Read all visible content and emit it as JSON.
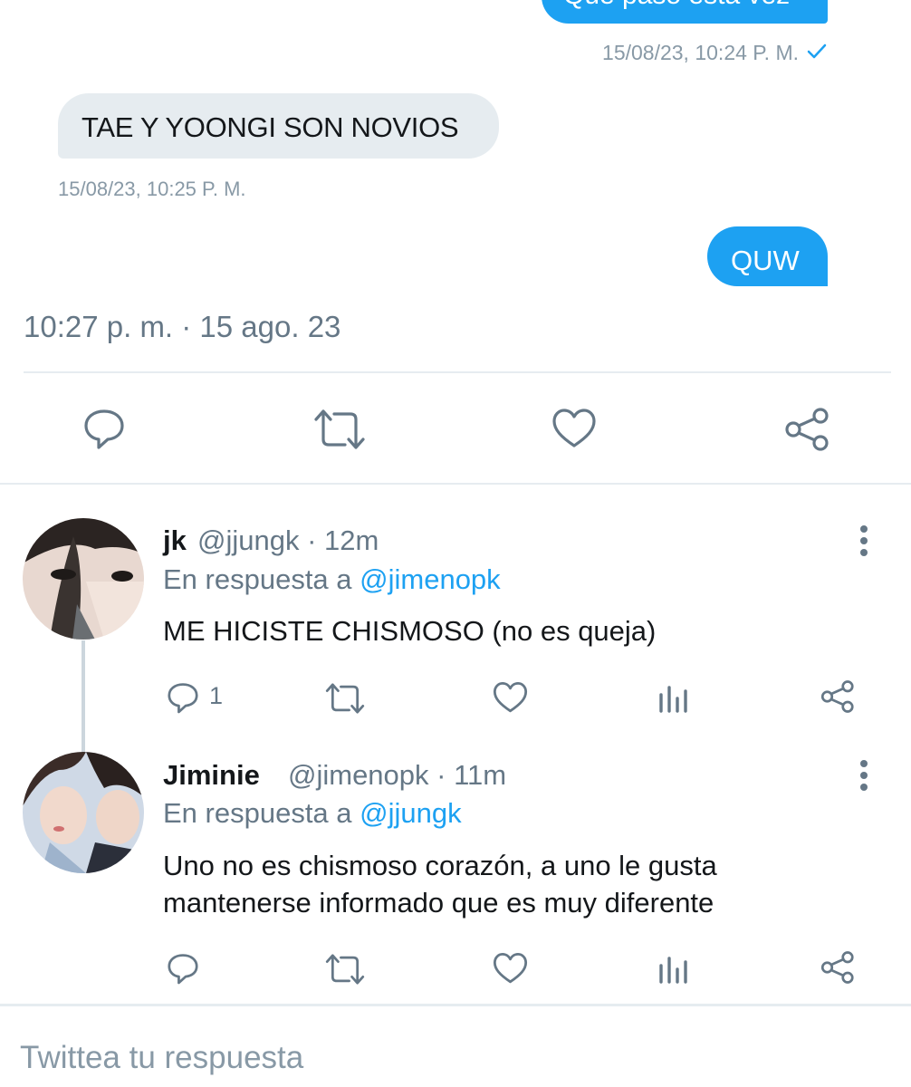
{
  "dm": {
    "top_bubble_text": "Que paso esta vez",
    "top_timestamp": "15/08/23, 10:24 P. M.",
    "incoming_text": "TAE Y YOONGI SON NOVIOS",
    "incoming_timestamp": "15/08/23, 10:25 P. M.",
    "quw_text": "QUW"
  },
  "tweet": {
    "time": "10:27 p. m. · 15 ago. 23"
  },
  "replies": [
    {
      "name": "jk",
      "handle": "@jjungk",
      "age": "· 12m",
      "reply_prefix": "En respuesta a ",
      "reply_to": "@jimenopk",
      "text": "ME HICISTE CHISMOSO (no es queja)",
      "reply_count": "1"
    },
    {
      "name": "Jiminie",
      "handle": "@jimenopk",
      "age": "· 11m",
      "reply_prefix": "En respuesta a ",
      "reply_to": "@jjungk",
      "text_line1": "Uno no es chismoso corazón, a uno le gusta",
      "text_line2": "mantenerse informado que es muy diferente"
    }
  ],
  "composer": {
    "placeholder": "Twittea tu respuesta"
  },
  "colors": {
    "accent": "#1da1f2",
    "icon": "#657786",
    "bubble_incoming": "#e6ecf0"
  },
  "icons": [
    "check-icon",
    "reply-icon",
    "retweet-icon",
    "like-icon",
    "share-icon",
    "analytics-icon",
    "more-icon"
  ]
}
